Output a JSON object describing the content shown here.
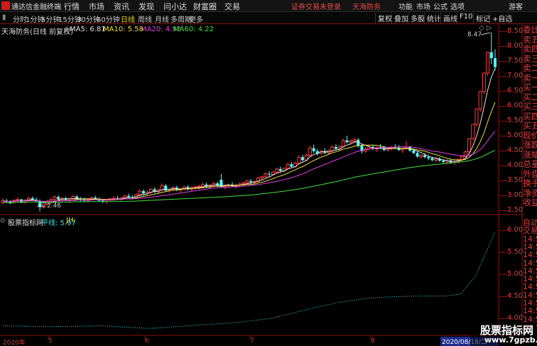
{
  "app": {
    "title": "通达信金融终端",
    "menu": [
      "行情",
      "市场",
      "资讯",
      "发现",
      "问小达",
      "财富圈",
      "交易"
    ],
    "status": [
      "证券交易未登录",
      "天海防务"
    ],
    "right": [
      "功能",
      "市场",
      "公式",
      "选项",
      "游客"
    ]
  },
  "toolbar": {
    "periods": [
      "分时",
      "1分钟",
      "5分钟",
      "15分钟",
      "30分钟",
      "60分钟",
      "日线",
      "周线",
      "月线",
      "多周期",
      "更多"
    ],
    "active": "日线",
    "buttons": [
      "复权",
      "叠加",
      "多股",
      "统计",
      "画线",
      "F10",
      "标记",
      "+自选"
    ]
  },
  "main": {
    "stock": "天海防务(日线 前复权)",
    "ma": [
      {
        "label": "MA5: 6.81",
        "color": "#e0e0e0"
      },
      {
        "label": "MA10: 5.58",
        "color": "#e8e040"
      },
      {
        "label": "MA20: 4.92",
        "color": "#e040e0"
      },
      {
        "label": "MA60: 4.22",
        "color": "#40e040"
      }
    ],
    "price_axis": [
      "8.50",
      "8.00",
      "7.50",
      "7.00",
      "6.50",
      "6.00",
      "5.50",
      "5.00",
      "4.50",
      "4.00",
      "3.50",
      "3.00",
      "2.50"
    ],
    "high_label": "8.47",
    "low_label": "2.46"
  },
  "indicator": {
    "name": "股票指标网",
    "pingxian": "平线: 5.97",
    "jh": "JH:",
    "axis": [
      "6.00",
      "5.50",
      "5.00",
      "4.50",
      "4.00"
    ]
  },
  "sidebar": {
    "items": [
      "委比",
      "卖五",
      "卖四",
      "卖三",
      "卖二",
      "卖一",
      "买一",
      "买二",
      "买三",
      "买四",
      "买五",
      "现价",
      "涨跌",
      "涨幅",
      "总量",
      "外盘",
      "换手",
      "净资",
      "收益"
    ],
    "lower": [
      "自动",
      "交易",
      "14:50",
      "14:50",
      "14:50",
      "14:50",
      "14:50",
      "14:50",
      "14:50",
      "14:50",
      "14:50",
      "14:50",
      "14:50",
      "14:50"
    ]
  },
  "date_axis": {
    "labels": [
      "2020年",
      "5",
      "6",
      "7",
      "8"
    ],
    "current": "2020/08/18/二"
  },
  "watermark": {
    "title": "股票指标网",
    "url": "www.7gpzb.com"
  },
  "chart_data": {
    "type": "candlestick",
    "x_range": [
      "2020-04",
      "2020-08-18"
    ],
    "ylim": [
      2.4,
      8.6
    ],
    "candles": [
      [
        2.75,
        2.9,
        2.7,
        2.82
      ],
      [
        2.82,
        2.88,
        2.74,
        2.78
      ],
      [
        2.78,
        2.84,
        2.7,
        2.76
      ],
      [
        2.76,
        2.86,
        2.72,
        2.83
      ],
      [
        2.83,
        2.92,
        2.78,
        2.86
      ],
      [
        2.86,
        2.88,
        2.74,
        2.77
      ],
      [
        2.77,
        2.86,
        2.73,
        2.84
      ],
      [
        2.84,
        2.94,
        2.8,
        2.9
      ],
      [
        2.9,
        2.96,
        2.82,
        2.85
      ],
      [
        2.85,
        2.92,
        2.78,
        2.8
      ],
      [
        2.8,
        2.86,
        2.46,
        2.6
      ],
      [
        2.6,
        2.72,
        2.55,
        2.7
      ],
      [
        2.7,
        2.84,
        2.66,
        2.8
      ],
      [
        2.8,
        2.9,
        2.74,
        2.86
      ],
      [
        2.86,
        3.0,
        2.8,
        2.94
      ],
      [
        2.94,
        3.0,
        2.82,
        2.86
      ],
      [
        2.86,
        2.94,
        2.8,
        2.9
      ],
      [
        2.9,
        2.96,
        2.82,
        2.84
      ],
      [
        2.84,
        2.92,
        2.78,
        2.88
      ],
      [
        2.88,
        3.02,
        2.84,
        2.96
      ],
      [
        2.96,
        3.0,
        2.84,
        2.88
      ],
      [
        2.88,
        2.94,
        2.8,
        2.86
      ],
      [
        2.86,
        2.92,
        2.78,
        2.82
      ],
      [
        2.82,
        2.9,
        2.76,
        2.86
      ],
      [
        2.86,
        2.96,
        2.82,
        2.92
      ],
      [
        2.92,
        2.98,
        2.84,
        2.86
      ],
      [
        2.86,
        2.92,
        2.78,
        2.82
      ],
      [
        2.82,
        2.88,
        2.74,
        2.8
      ],
      [
        2.8,
        2.86,
        2.72,
        2.84
      ],
      [
        2.84,
        2.92,
        2.8,
        2.88
      ],
      [
        2.88,
        2.96,
        2.82,
        2.9
      ],
      [
        2.9,
        2.98,
        2.84,
        2.86
      ],
      [
        2.86,
        2.94,
        2.82,
        2.92
      ],
      [
        2.92,
        3.02,
        2.88,
        2.98
      ],
      [
        2.98,
        3.06,
        2.9,
        2.94
      ],
      [
        2.94,
        3.0,
        2.86,
        2.92
      ],
      [
        2.92,
        3.06,
        2.88,
        3.02
      ],
      [
        3.02,
        3.2,
        2.98,
        3.14
      ],
      [
        3.14,
        3.2,
        3.0,
        3.06
      ],
      [
        3.06,
        3.16,
        3.0,
        3.1
      ],
      [
        3.1,
        3.24,
        3.04,
        3.2
      ],
      [
        3.2,
        3.26,
        3.08,
        3.12
      ],
      [
        3.12,
        3.22,
        3.06,
        3.18
      ],
      [
        3.18,
        3.4,
        3.14,
        3.32
      ],
      [
        3.32,
        3.38,
        3.12,
        3.16
      ],
      [
        3.16,
        3.24,
        3.08,
        3.2
      ],
      [
        3.2,
        3.3,
        3.14,
        3.26
      ],
      [
        3.26,
        3.32,
        3.14,
        3.18
      ],
      [
        3.18,
        3.24,
        3.1,
        3.22
      ],
      [
        3.22,
        3.32,
        3.16,
        3.28
      ],
      [
        3.28,
        3.34,
        3.16,
        3.2
      ],
      [
        3.2,
        3.3,
        3.14,
        3.26
      ],
      [
        3.26,
        3.32,
        3.18,
        3.28
      ],
      [
        3.28,
        3.36,
        3.2,
        3.3
      ],
      [
        3.3,
        3.42,
        3.24,
        3.36
      ],
      [
        3.36,
        3.42,
        3.24,
        3.3
      ],
      [
        3.3,
        3.38,
        3.22,
        3.34
      ],
      [
        3.34,
        3.44,
        3.28,
        3.4
      ],
      [
        3.4,
        3.46,
        3.28,
        3.32
      ],
      [
        3.52,
        3.72,
        3.4,
        3.28
      ],
      [
        3.28,
        3.36,
        3.2,
        3.32
      ],
      [
        3.32,
        3.4,
        3.24,
        3.36
      ],
      [
        3.36,
        3.44,
        3.28,
        3.3
      ],
      [
        3.3,
        3.38,
        3.24,
        3.34
      ],
      [
        3.34,
        3.42,
        3.28,
        3.38
      ],
      [
        3.38,
        3.46,
        3.3,
        3.42
      ],
      [
        3.42,
        3.52,
        3.36,
        3.48
      ],
      [
        3.48,
        3.54,
        3.38,
        3.44
      ],
      [
        3.44,
        3.5,
        3.38,
        3.46
      ],
      [
        3.46,
        3.62,
        3.42,
        3.58
      ],
      [
        3.58,
        3.66,
        3.5,
        3.62
      ],
      [
        3.62,
        3.76,
        3.58,
        3.72
      ],
      [
        3.72,
        3.8,
        3.62,
        3.7
      ],
      [
        3.7,
        3.82,
        3.66,
        3.78
      ],
      [
        3.78,
        3.92,
        3.72,
        3.88
      ],
      [
        3.88,
        3.96,
        3.76,
        3.82
      ],
      [
        3.82,
        3.94,
        3.78,
        3.9
      ],
      [
        3.9,
        4.1,
        3.86,
        4.04
      ],
      [
        4.04,
        4.12,
        3.92,
        3.96
      ],
      [
        3.96,
        4.12,
        3.92,
        4.08
      ],
      [
        4.08,
        4.34,
        4.04,
        4.28
      ],
      [
        4.28,
        4.36,
        4.12,
        4.18
      ],
      [
        4.18,
        4.4,
        4.14,
        4.34
      ],
      [
        4.34,
        4.66,
        4.3,
        4.58
      ],
      [
        4.58,
        4.7,
        4.42,
        4.48
      ],
      [
        4.48,
        4.56,
        4.34,
        4.4
      ],
      [
        4.4,
        4.52,
        4.36,
        4.48
      ],
      [
        4.48,
        4.58,
        4.38,
        4.42
      ],
      [
        4.42,
        4.54,
        4.36,
        4.5
      ],
      [
        4.5,
        4.68,
        4.46,
        4.62
      ],
      [
        4.62,
        4.72,
        4.5,
        4.56
      ],
      [
        4.56,
        4.68,
        4.52,
        4.64
      ],
      [
        4.64,
        4.9,
        4.6,
        4.84
      ],
      [
        4.84,
        5.0,
        4.74,
        4.78
      ],
      [
        4.78,
        4.88,
        4.7,
        4.82
      ],
      [
        4.82,
        4.94,
        4.76,
        4.86
      ],
      [
        4.86,
        4.92,
        4.6,
        4.66
      ],
      [
        4.66,
        4.72,
        4.4,
        4.48
      ],
      [
        4.48,
        4.62,
        4.42,
        4.56
      ],
      [
        4.56,
        4.68,
        4.5,
        4.62
      ],
      [
        4.62,
        4.7,
        4.52,
        4.56
      ],
      [
        4.56,
        4.64,
        4.46,
        4.6
      ],
      [
        4.6,
        4.72,
        4.54,
        4.58
      ],
      [
        4.58,
        4.66,
        4.48,
        4.52
      ],
      [
        4.52,
        4.62,
        4.46,
        4.56
      ],
      [
        4.56,
        4.66,
        4.5,
        4.62
      ],
      [
        4.62,
        4.72,
        4.54,
        4.6
      ],
      [
        4.6,
        4.68,
        4.48,
        4.52
      ],
      [
        4.52,
        4.6,
        4.42,
        4.56
      ],
      [
        4.56,
        4.82,
        4.52,
        4.62
      ],
      [
        4.62,
        4.66,
        4.46,
        4.5
      ],
      [
        4.5,
        4.56,
        4.38,
        4.42
      ],
      [
        4.42,
        4.48,
        4.26,
        4.3
      ],
      [
        4.3,
        4.38,
        4.22,
        4.34
      ],
      [
        4.34,
        4.42,
        4.24,
        4.28
      ],
      [
        4.28,
        4.34,
        4.18,
        4.24
      ],
      [
        4.24,
        4.3,
        4.14,
        4.18
      ],
      [
        4.18,
        4.26,
        4.1,
        4.22
      ],
      [
        4.22,
        4.28,
        4.12,
        4.16
      ],
      [
        4.16,
        4.22,
        4.06,
        4.12
      ],
      [
        4.12,
        4.2,
        4.04,
        4.16
      ],
      [
        4.16,
        4.22,
        4.06,
        4.1
      ],
      [
        4.1,
        4.18,
        4.02,
        4.14
      ],
      [
        4.14,
        4.24,
        4.08,
        4.2
      ],
      [
        4.2,
        4.34,
        4.14,
        4.3
      ],
      [
        4.3,
        4.5,
        4.24,
        4.46
      ],
      [
        4.46,
        4.92,
        4.42,
        4.9
      ],
      [
        4.9,
        5.4,
        4.86,
        5.38
      ],
      [
        5.38,
        5.92,
        5.3,
        5.9
      ],
      [
        5.9,
        6.5,
        5.8,
        6.48
      ],
      [
        6.48,
        7.12,
        6.4,
        7.1
      ],
      [
        7.1,
        7.82,
        7.0,
        7.8
      ],
      [
        7.8,
        8.47,
        7.4,
        7.6
      ],
      [
        7.6,
        7.9,
        7.2,
        7.3
      ]
    ],
    "ma_periods": [
      5,
      10,
      20,
      60
    ],
    "indicator_series": {
      "name": "平线",
      "last": 5.97,
      "ylim": [
        3.7,
        6.2
      ],
      "points": [
        [
          0,
          3.82
        ],
        [
          0.1,
          3.8
        ],
        [
          0.2,
          3.82
        ],
        [
          0.3,
          3.76
        ],
        [
          0.4,
          3.84
        ],
        [
          0.48,
          3.9
        ],
        [
          0.55,
          4.0
        ],
        [
          0.62,
          4.2
        ],
        [
          0.68,
          4.35
        ],
        [
          0.74,
          4.45
        ],
        [
          0.78,
          4.48
        ],
        [
          0.84,
          4.5
        ],
        [
          0.9,
          4.5
        ],
        [
          0.93,
          4.55
        ],
        [
          0.96,
          4.95
        ],
        [
          1,
          5.97
        ]
      ]
    }
  }
}
